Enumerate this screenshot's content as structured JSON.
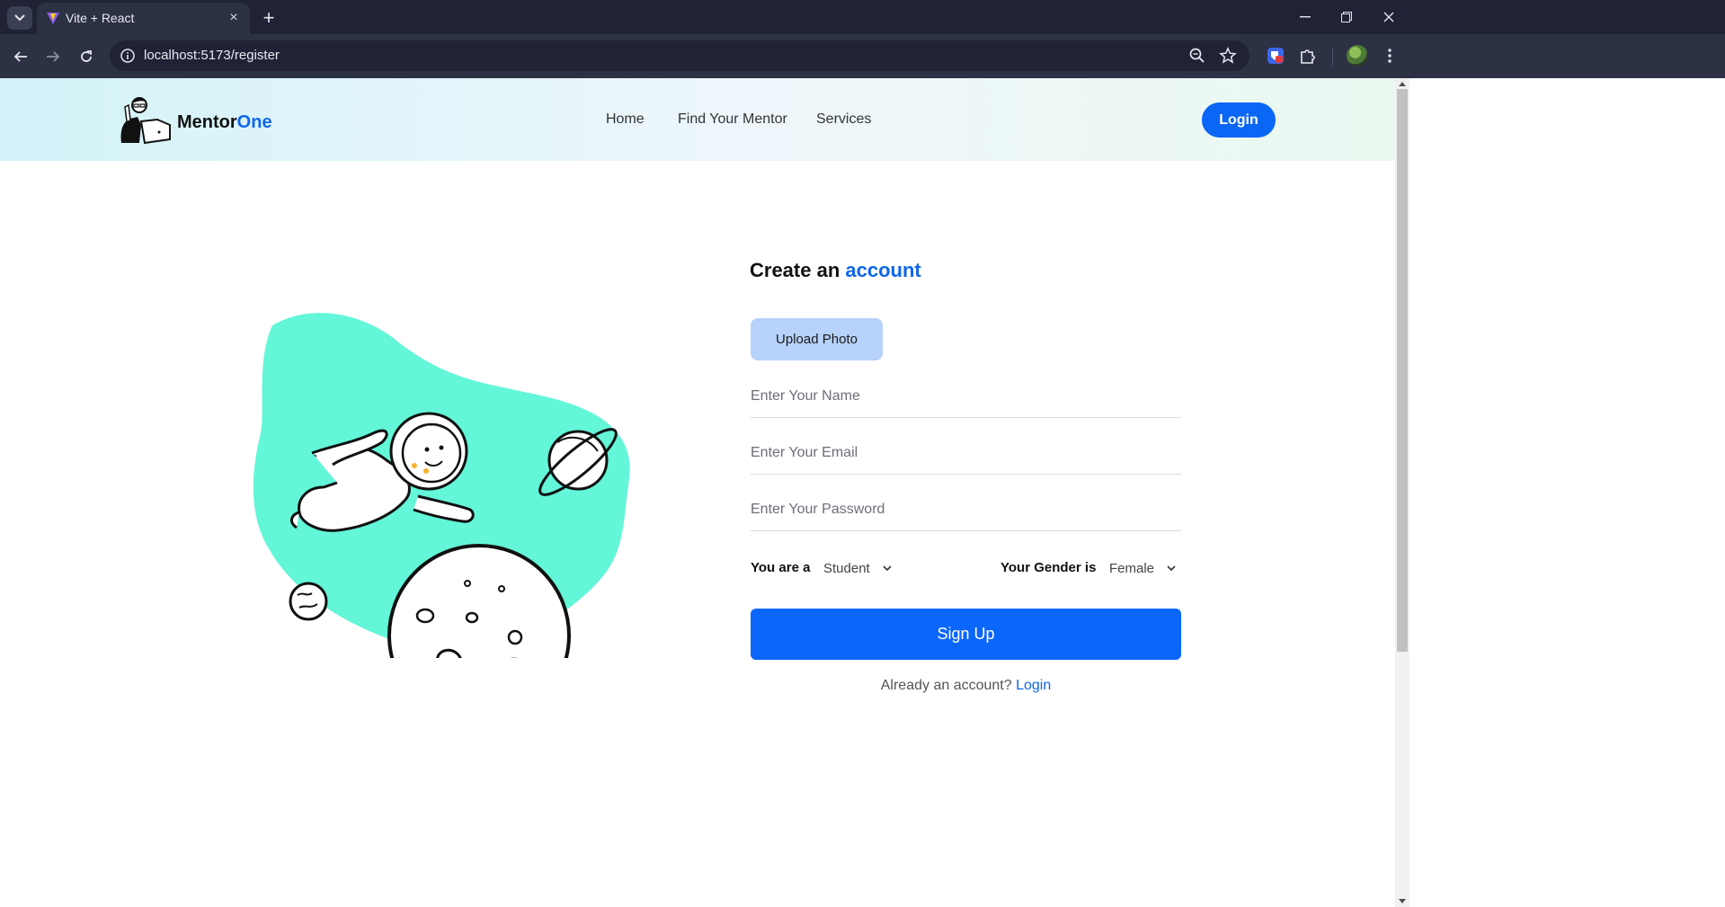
{
  "browser": {
    "tab_title": "Vite + React",
    "tab_close": "×",
    "new_tab": "+",
    "url": "localhost:5173/register"
  },
  "site": {
    "brand_primary": "Mentor",
    "brand_accent": "One",
    "nav": [
      "Home",
      "Find Your Mentor",
      "Services"
    ],
    "login_label": "Login"
  },
  "form": {
    "title_prefix": "Create an",
    "title_accent": "account",
    "upload_label": "Upload Photo",
    "name_placeholder": "Enter Your Name",
    "email_placeholder": "Enter Your Email",
    "password_placeholder": "Enter Your Password",
    "role_label": "You are a",
    "role_value": "Student",
    "gender_label": "Your Gender is",
    "gender_value": "Female",
    "submit_label": "Sign Up",
    "already_text": "Already an account?",
    "login_link": "Login"
  },
  "colors": {
    "accent": "#0f66e8",
    "button": "#0b66fb",
    "upload_bg": "#b7d2fb",
    "art_blob": "#63f6d8",
    "chrome_dark": "#1f2335"
  },
  "icons": [
    "chevron-down-icon",
    "vite-favicon",
    "close-icon",
    "plus-icon",
    "minimize-icon",
    "restore-icon",
    "window-close-icon",
    "back-arrow-icon",
    "forward-arrow-icon",
    "reload-icon",
    "site-info-icon",
    "zoom-icon",
    "star-icon",
    "extension-shield-icon",
    "puzzle-icon",
    "menu-dots-icon"
  ]
}
